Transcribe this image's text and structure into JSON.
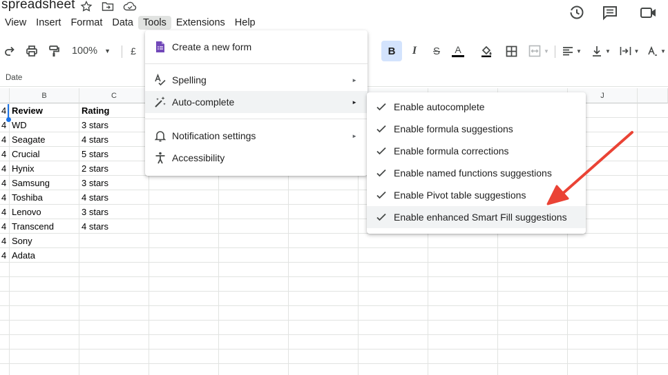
{
  "title": {
    "doc_name": "spreadsheet"
  },
  "menubar": {
    "items": [
      {
        "label": "View"
      },
      {
        "label": "Insert"
      },
      {
        "label": "Format"
      },
      {
        "label": "Data"
      },
      {
        "label": "Tools",
        "active": true
      },
      {
        "label": "Extensions"
      },
      {
        "label": "Help"
      }
    ]
  },
  "toolbar": {
    "zoom": "100%",
    "currency": "£"
  },
  "namebox": {
    "value": "Date"
  },
  "columns": [
    "B",
    "C",
    "J"
  ],
  "rows": [
    {
      "a": "4",
      "b": "Review",
      "c": "Rating",
      "header": true
    },
    {
      "a": "4",
      "b": "WD",
      "c": "3 stars"
    },
    {
      "a": "4",
      "b": "Seagate",
      "c": "4 stars"
    },
    {
      "a": "4",
      "b": "Crucial",
      "c": "5 stars"
    },
    {
      "a": "4",
      "b": "Hynix",
      "c": "2 stars"
    },
    {
      "a": "4",
      "b": "Samsung",
      "c": "3 stars"
    },
    {
      "a": "4",
      "b": "Toshiba",
      "c": "4 stars"
    },
    {
      "a": "4",
      "b": "Lenovo",
      "c": "3 stars"
    },
    {
      "a": "4",
      "b": "Transcend",
      "c": "4 stars"
    },
    {
      "a": "4",
      "b": "Sony",
      "c": ""
    },
    {
      "a": "4",
      "b": "Adata",
      "c": ""
    }
  ],
  "tools_menu": {
    "items": [
      {
        "label": "Create a new form",
        "icon": "forms-icon"
      },
      {
        "label": "Spelling",
        "icon": "spelling-icon",
        "submenu": true
      },
      {
        "label": "Auto-complete",
        "icon": "magic-wand-icon",
        "submenu": true,
        "highlighted": true
      },
      {
        "label": "Notification settings",
        "icon": "bell-icon",
        "submenu": true
      },
      {
        "label": "Accessibility",
        "icon": "accessibility-icon"
      }
    ],
    "submenu_arrow": "►"
  },
  "autocomplete_submenu": {
    "items": [
      {
        "label": "Enable autocomplete",
        "checked": true
      },
      {
        "label": "Enable formula suggestions",
        "checked": true
      },
      {
        "label": "Enable formula corrections",
        "checked": true
      },
      {
        "label": "Enable named functions suggestions",
        "checked": true
      },
      {
        "label": "Enable Pivot table suggestions",
        "checked": true
      },
      {
        "label": "Enable enhanced Smart Fill suggestions",
        "checked": true,
        "highlighted": true
      }
    ]
  },
  "colors": {
    "accent": "#1a73e8",
    "annotation_arrow": "#ea4335",
    "selected_bg": "#d3e3fd"
  }
}
